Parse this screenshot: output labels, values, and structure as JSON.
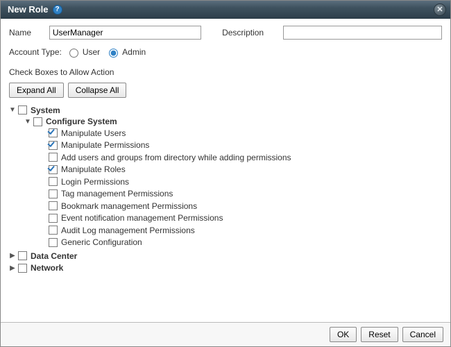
{
  "dialog": {
    "title": "New Role",
    "help_glyph": "?",
    "close_glyph": "✕"
  },
  "form": {
    "name_label": "Name",
    "name_value": "UserManager",
    "desc_label": "Description",
    "desc_value": "",
    "account_type_label": "Account Type:",
    "account_type_options": {
      "user": "User",
      "admin": "Admin"
    },
    "account_type_selected": "admin"
  },
  "section": {
    "heading": "Check Boxes to Allow Action",
    "expand_all": "Expand All",
    "collapse_all": "Collapse All"
  },
  "tree": [
    {
      "id": "system",
      "label": "System",
      "expanded": true,
      "checked": false,
      "children": [
        {
          "id": "configure-system",
          "label": "Configure System",
          "expanded": true,
          "checked": false,
          "children": [
            {
              "id": "manipulate-users",
              "label": "Manipulate Users",
              "checked": true
            },
            {
              "id": "manipulate-permissions",
              "label": "Manipulate Permissions",
              "checked": true
            },
            {
              "id": "add-users-groups-directory",
              "label": "Add users and groups from directory while adding permissions",
              "checked": false
            },
            {
              "id": "manipulate-roles",
              "label": "Manipulate Roles",
              "checked": true
            },
            {
              "id": "login-permissions",
              "label": "Login Permissions",
              "checked": false
            },
            {
              "id": "tag-management-permissions",
              "label": "Tag management Permissions",
              "checked": false
            },
            {
              "id": "bookmark-management-permissions",
              "label": "Bookmark management Permissions",
              "checked": false
            },
            {
              "id": "event-notification-management-permissions",
              "label": "Event notification management Permissions",
              "checked": false
            },
            {
              "id": "audit-log-management-permissions",
              "label": "Audit Log management Permissions",
              "checked": false
            },
            {
              "id": "generic-configuration",
              "label": "Generic Configuration",
              "checked": false
            }
          ]
        }
      ]
    },
    {
      "id": "data-center",
      "label": "Data Center",
      "expanded": false,
      "checked": false,
      "children": []
    },
    {
      "id": "network",
      "label": "Network",
      "expanded": false,
      "checked": false,
      "children": []
    }
  ],
  "footer": {
    "ok": "OK",
    "reset": "Reset",
    "cancel": "Cancel"
  },
  "glyphs": {
    "caret_expanded": "▼",
    "caret_collapsed": "▶"
  }
}
